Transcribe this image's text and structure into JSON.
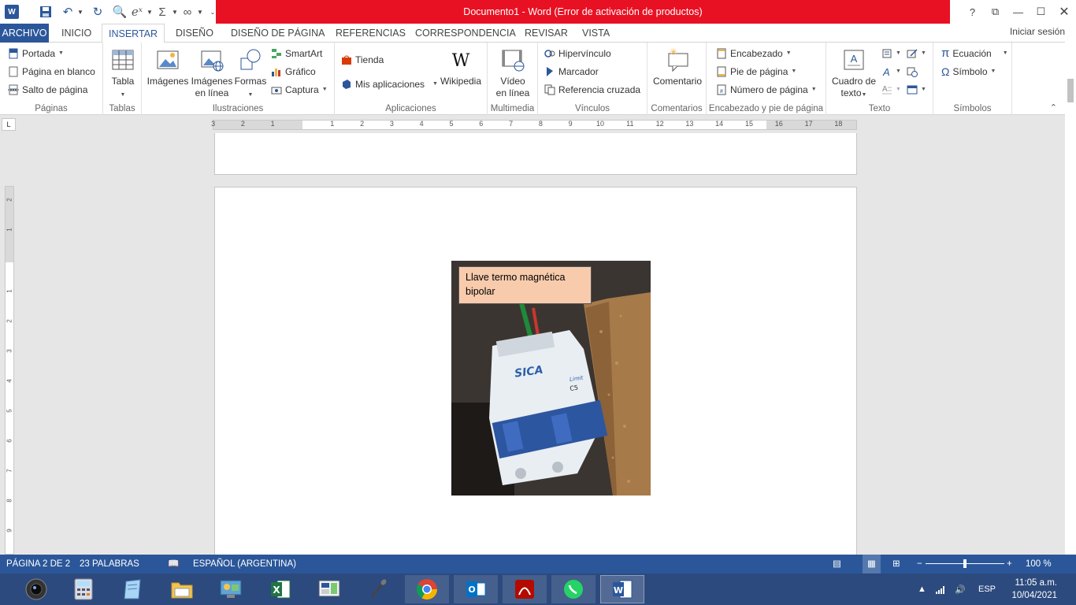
{
  "window": {
    "title": "Documento1 -  Word (Error de activación de productos)",
    "accent": "#2b579a",
    "alert_color": "#e81123"
  },
  "qat": {
    "app_icon": "word-icon",
    "items": [
      "save-icon",
      "undo-icon",
      "redo-icon",
      "print-preview-icon",
      "equation-icon",
      "sum-icon",
      "infinity-icon",
      "customize-icon"
    ]
  },
  "window_controls": {
    "help": "?",
    "ribbon_display": "⧉",
    "minimize": "—",
    "maximize": "☐",
    "close": "✕"
  },
  "tabs": {
    "file": "ARCHIVO",
    "items": [
      "INICIO",
      "INSERTAR",
      "DISEÑO",
      "DISEÑO DE PÁGINA",
      "REFERENCIAS",
      "CORRESPONDENCIA",
      "REVISAR",
      "VISTA"
    ],
    "active": "INSERTAR",
    "signin": "Iniciar sesión"
  },
  "ribbon": {
    "paginas": {
      "label": "Páginas",
      "portada": "Portada",
      "blanco": "Página en blanco",
      "salto": "Salto de página"
    },
    "tablas": {
      "label": "Tablas",
      "tabla": "Tabla"
    },
    "ilustraciones": {
      "label": "Ilustraciones",
      "imagenes": "Imágenes",
      "imagenes_linea_1": "Imágenes",
      "imagenes_linea_2": "en línea",
      "formas": "Formas",
      "smartart": "SmartArt",
      "grafico": "Gráfico",
      "captura": "Captura"
    },
    "aplicaciones": {
      "label": "Aplicaciones",
      "tienda": "Tienda",
      "mis_apps": "Mis aplicaciones",
      "wikipedia": "Wikipedia"
    },
    "multimedia": {
      "label": "Multimedia",
      "video_1": "Vídeo",
      "video_2": "en línea"
    },
    "vinculos": {
      "label": "Vínculos",
      "hipervinculo": "Hipervínculo",
      "marcador": "Marcador",
      "referencia": "Referencia cruzada"
    },
    "comentarios": {
      "label": "Comentarios",
      "comentario": "Comentario"
    },
    "encabezado": {
      "label": "Encabezado y pie de página",
      "encabezado": "Encabezado",
      "pie": "Pie de página",
      "numero": "Número de página"
    },
    "texto": {
      "label": "Texto",
      "cuadro_1": "Cuadro de",
      "cuadro_2": "texto"
    },
    "simbolos": {
      "label": "Símbolos",
      "ecuacion": "Ecuación",
      "simbolo": "Símbolo"
    }
  },
  "ruler": {
    "tab_selector": "L",
    "numbers": [
      "3",
      "2",
      "1",
      "1",
      "2",
      "3",
      "4",
      "5",
      "6",
      "7",
      "8",
      "9",
      "10",
      "11",
      "12",
      "13",
      "14",
      "15",
      "16",
      "17",
      "18"
    ],
    "vnumbers": [
      "2",
      "1",
      "1",
      "2",
      "3",
      "4",
      "5",
      "6",
      "7",
      "8",
      "9"
    ]
  },
  "document": {
    "caption": "Llave termo magnética bipolar",
    "photo_brand": "SICA",
    "photo_label_rating": "C5",
    "photo_label_limit": "Limit"
  },
  "status": {
    "page": "PÁGINA 2 DE 2",
    "words": "23 PALABRAS",
    "language": "ESPAÑOL (ARGENTINA)",
    "zoom": "100 %",
    "zoom_level": 100
  },
  "taskbar": {
    "apps": [
      "camera-icon",
      "calculator-icon",
      "notepad-icon",
      "file-explorer-icon",
      "control-panel-icon",
      "excel-icon",
      "remote-desktop-icon",
      "microphone-icon",
      "chrome-icon",
      "outlook-icon",
      "acrobat-icon",
      "whatsapp-icon",
      "word-icon"
    ],
    "active": "word-icon",
    "language": "ESP",
    "time": "11:05 a.m.",
    "date": "10/04/2021"
  }
}
